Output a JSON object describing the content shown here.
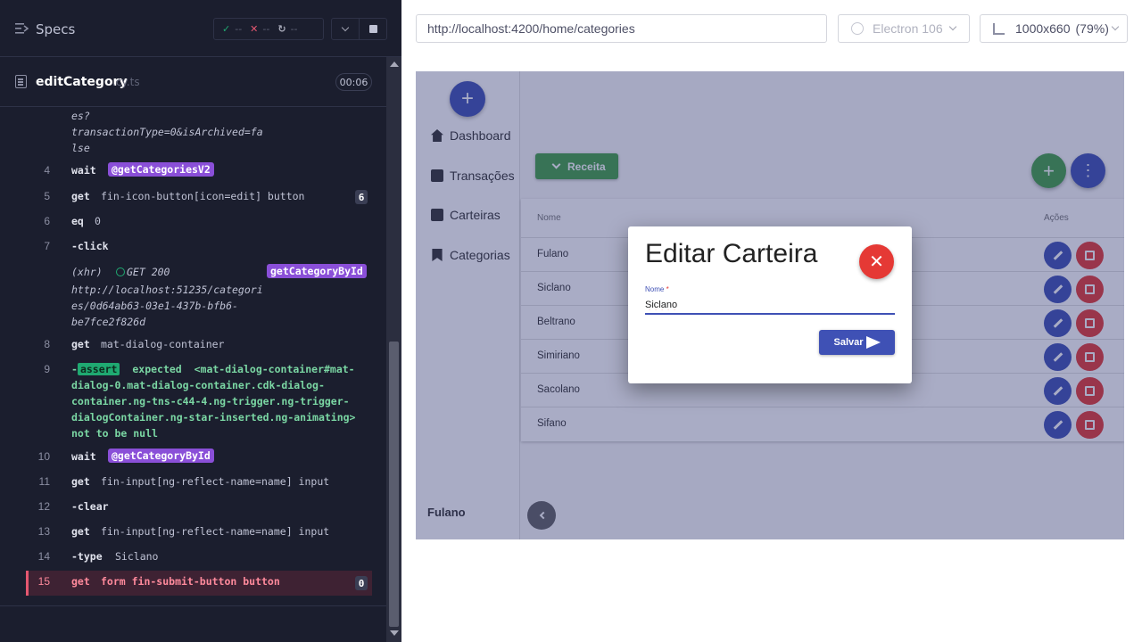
{
  "runner": {
    "specs_title": "Specs",
    "stats": {
      "passed": "--",
      "failed": "--",
      "pending": "--"
    },
    "spec": {
      "name": "editCategory",
      "ext": ".cy.ts",
      "duration": "00:06"
    },
    "commands": {
      "c3_tail": [
        "es?",
        "transactionType=0&isArchived=fa",
        "lse"
      ],
      "c4": {
        "num": "4",
        "name": "wait",
        "alias": "@getCategoriesV2"
      },
      "c5": {
        "num": "5",
        "name": "get",
        "msg": "fin-icon-button[icon=edit] button",
        "count": "6"
      },
      "c6": {
        "num": "6",
        "name": "eq",
        "msg": "0"
      },
      "c7": {
        "num": "7",
        "name": "-click"
      },
      "xhr": {
        "prefix": "(xhr)",
        "status": "GET 200",
        "alias": "getCategoryById",
        "url_lines": [
          "http://localhost:51235/categori",
          "es/0d64ab63-03e1-437b-bfb6-",
          "be7fce2f826d"
        ]
      },
      "c8": {
        "num": "8",
        "name": "get",
        "msg": "mat-dialog-container"
      },
      "c9": {
        "num": "9",
        "dash": "-",
        "tag": "assert",
        "expected": "expected",
        "lines": [
          "<mat-dialog-container#mat-",
          "dialog-0.mat-dialog-container.cdk-dialog-",
          "container.ng-tns-c44-4.ng-trigger.ng-trigger-",
          "dialogContainer.ng-star-inserted.ng-animating>",
          "not to be null"
        ]
      },
      "c10": {
        "num": "10",
        "name": "wait",
        "alias": "@getCategoryById"
      },
      "c11": {
        "num": "11",
        "name": "get",
        "msg": "fin-input[ng-reflect-name=name] input"
      },
      "c12": {
        "num": "12",
        "name": "-clear"
      },
      "c13": {
        "num": "13",
        "name": "get",
        "msg": "fin-input[ng-reflect-name=name] input"
      },
      "c14": {
        "num": "14",
        "name": "-type",
        "msg": "Siclano"
      },
      "c15": {
        "num": "15",
        "name": "get",
        "msg": "form fin-submit-button button",
        "count": "0"
      }
    }
  },
  "aut": {
    "url": "http://localhost:4200/home/categories",
    "browser": "Electron 106",
    "viewport": "1000x660",
    "zoom": "(79%)"
  },
  "app": {
    "nav": {
      "items": [
        {
          "label": "Dashboard",
          "icon": "home-icon"
        },
        {
          "label": "Transações",
          "icon": "chart-icon"
        },
        {
          "label": "Carteiras",
          "icon": "wallet-icon"
        },
        {
          "label": "Categorias",
          "icon": "bookmark-icon"
        }
      ],
      "user": "Fulano"
    },
    "receita_label": "Receita",
    "table": {
      "col_name": "Nome",
      "col_actions": "Ações",
      "rows": [
        "Fulano",
        "Siclano",
        "Beltrano",
        "Simiriano",
        "Sacolano",
        "Sifano"
      ]
    },
    "dialog": {
      "title": "Editar Carteira",
      "field_label": "Nome",
      "required_mark": "*",
      "field_value": "Siclano",
      "save_label": "Salvar"
    }
  },
  "colors": {
    "primary": "#3f51b5",
    "success": "#43a047",
    "danger": "#e53935",
    "runner_bg": "#1b1e2e",
    "alias": "#8a4fd8"
  }
}
